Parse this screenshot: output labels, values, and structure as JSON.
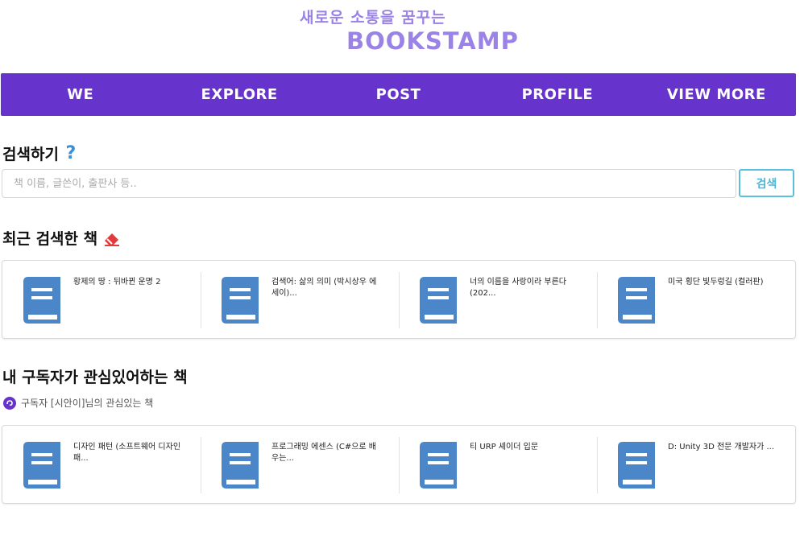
{
  "header": {
    "tagline": "새로운 소통을 꿈꾸는",
    "brand": "BOOKSTAMP"
  },
  "nav": {
    "items": [
      {
        "label": "WE"
      },
      {
        "label": "EXPLORE"
      },
      {
        "label": "POST"
      },
      {
        "label": "PROFILE"
      },
      {
        "label": "VIEW MORE"
      }
    ]
  },
  "search": {
    "title": "검색하기",
    "placeholder": "책 이름, 글쓴이, 출판사 등..",
    "value": "",
    "button_label": "검색"
  },
  "recent": {
    "title": "최근 검색한 책",
    "books": [
      {
        "title": "황제의 땅 : 뒤바뀐 운명 2"
      },
      {
        "title": "검색어: 삶의 의미 (박시상우 에세이)..."
      },
      {
        "title": "너의 이름을 사랑이라 부른다 (202..."
      },
      {
        "title": "미국 횡단 빛두렁길 (컬러판)"
      }
    ]
  },
  "subscribers": {
    "title": "내 구독자가 관심있어하는 책",
    "subtitle": "구독자 [시안이]님의 관심있는 책",
    "books": [
      {
        "title": "디자인 패턴 (소프트웨어 디자인 패..."
      },
      {
        "title": "프로그래밍 에센스 (C#으로 배우는..."
      },
      {
        "title": "티 URP 셰이더 입문"
      },
      {
        "title": "D: Unity 3D 전문 개발자가 ..."
      }
    ]
  },
  "colors": {
    "nav_bg": "#6633cc",
    "brand": "#9b82e6",
    "book_icon": "#4a86c8",
    "search_button_border": "#5bc0de"
  },
  "icons": {
    "help": "question-circle-icon",
    "eraser": "eraser-icon",
    "book": "book-icon",
    "subscriber": "avatar-icon"
  }
}
